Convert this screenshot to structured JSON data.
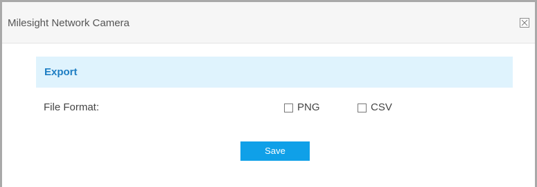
{
  "dialog": {
    "title": "Milesight Network Camera",
    "close_symbol": "✕"
  },
  "section": {
    "title": "Export"
  },
  "file_format": {
    "label": "File Format:",
    "options": [
      {
        "label": "PNG",
        "checked": false
      },
      {
        "label": "CSV",
        "checked": false
      }
    ]
  },
  "actions": {
    "save_label": "Save"
  },
  "colors": {
    "accent": "#0fa0e8",
    "section_bg": "#dff3fd",
    "section_title": "#1e7ec3"
  },
  "icons": {
    "close": "close-icon",
    "checkbox": "checkbox-icon"
  }
}
